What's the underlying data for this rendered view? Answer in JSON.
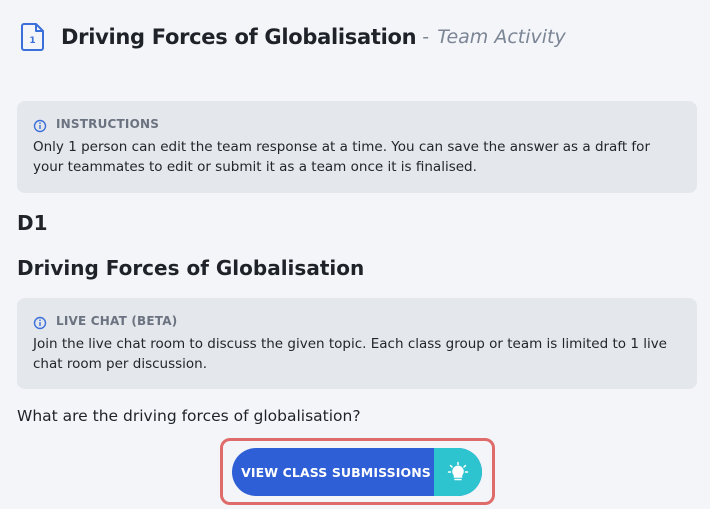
{
  "header": {
    "doc_icon_number": "1",
    "title": "Driving Forces of Globalisation",
    "subtitle_dash": "-",
    "subtitle": "Team Activity"
  },
  "instructions": {
    "label": "INSTRUCTIONS",
    "text": "Only 1 person can edit the team response at a time. You can save the answer as a draft for your teammates to edit or submit it as a team once it is finalised."
  },
  "section": {
    "code": "D1",
    "title": "Driving Forces of Globalisation"
  },
  "live_chat": {
    "label": "LIVE CHAT (BETA)",
    "text": "Join the live chat room to discuss the given topic. Each class group or team is limited to 1 live chat room per discussion."
  },
  "question": {
    "text": "What are the driving forces of globalisation?"
  },
  "view_button": {
    "label": "VIEW CLASS SUBMISSIONS",
    "icon": "lightbulb-icon"
  },
  "colors": {
    "background": "#f3f5f8",
    "info_box": "#e4e7eb",
    "button_primary": "#2f5fd6",
    "button_icon_bg": "#2ec4cf",
    "highlight_outline": "#e06b6b",
    "icon_blue": "#3b6fd9"
  }
}
